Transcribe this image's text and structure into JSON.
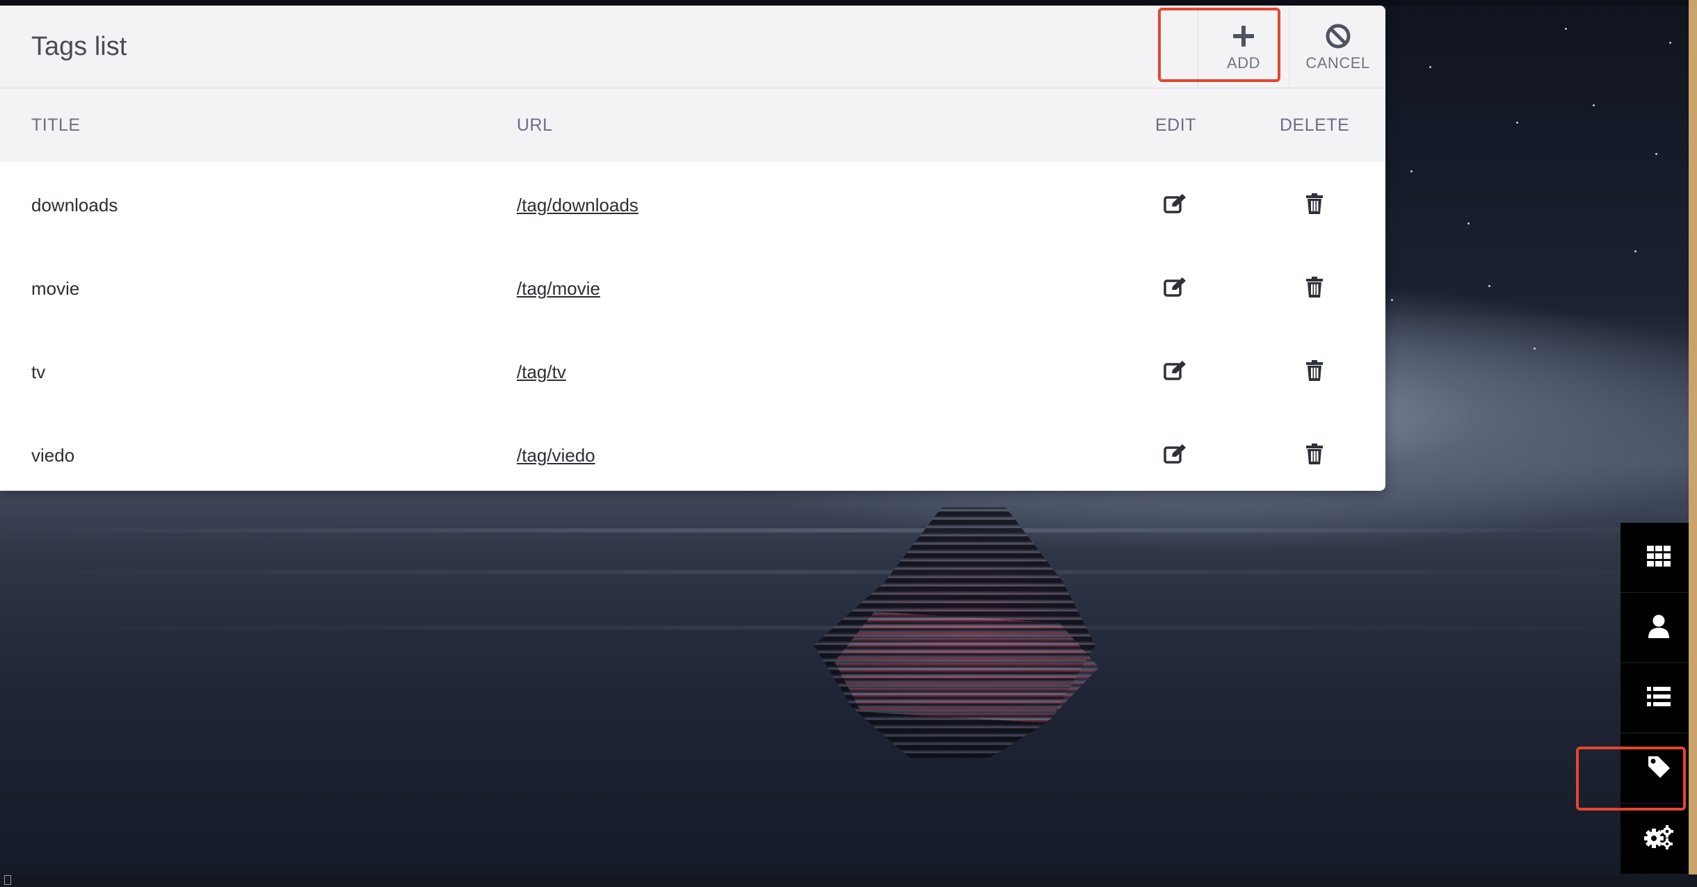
{
  "panel": {
    "title": "Tags list",
    "buttons": {
      "add_label": "ADD",
      "cancel_label": "CANCEL"
    }
  },
  "table": {
    "columns": [
      "TITLE",
      "URL",
      "EDIT",
      "DELETE"
    ],
    "rows": [
      {
        "title": "downloads",
        "url": "/tag/downloads"
      },
      {
        "title": "movie",
        "url": "/tag/movie"
      },
      {
        "title": "tv",
        "url": "/tag/tv"
      },
      {
        "title": "viedo",
        "url": "/tag/viedo"
      }
    ]
  },
  "dock": {
    "items": [
      "grid-icon",
      "user-icon",
      "list-icon",
      "tag-icon",
      "cogs-icon"
    ],
    "highlighted": "tag-icon"
  },
  "colors": {
    "highlight": "#e5452f",
    "panel_header": "#f3f3f5",
    "dock_bg": "#000000"
  }
}
